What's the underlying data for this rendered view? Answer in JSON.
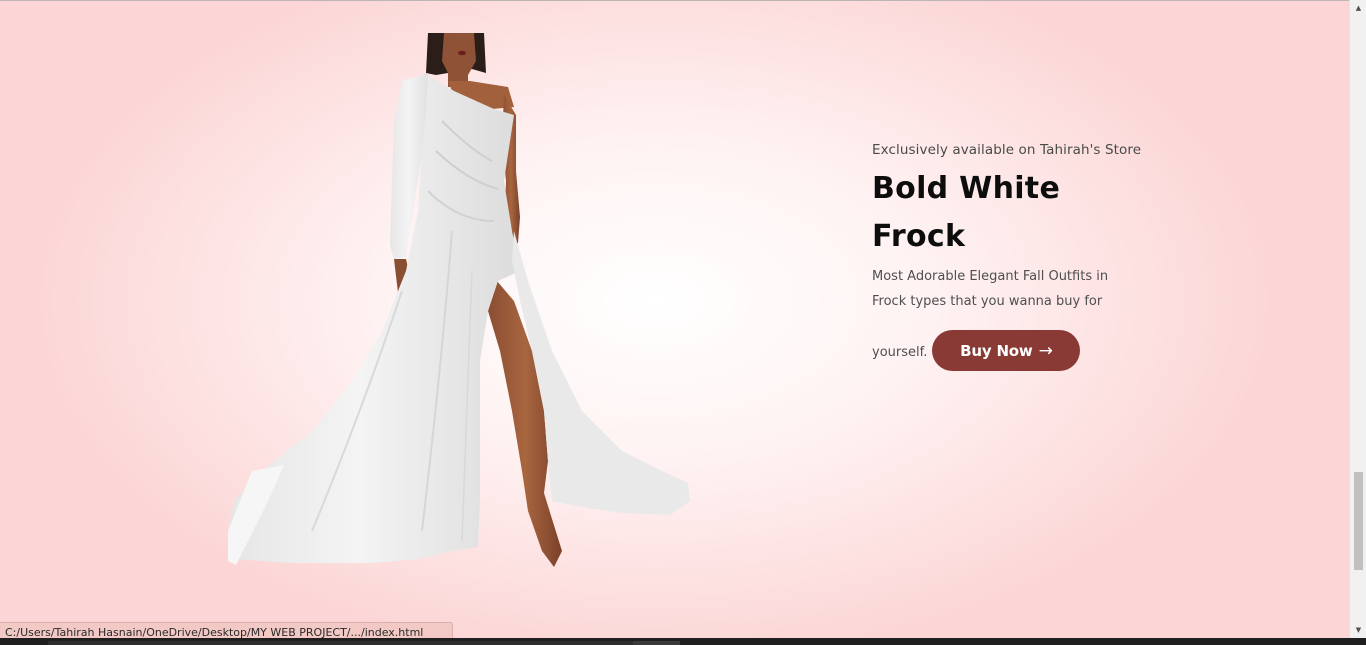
{
  "hero": {
    "eyebrow": "Exclusively available on Tahirah's Store",
    "title": "Bold White Frock",
    "description": "Most Adorable Elegant Fall Outfits in Frock types that you wanna buy for",
    "description_tail": "yourself.",
    "button_label": "Buy Now",
    "button_arrow": "→",
    "button_color": "#8a3a34"
  },
  "product_image": {
    "icon": "white-dress-model-image"
  },
  "status_bar": {
    "url": "C:/Users/Tahirah Hasnain/OneDrive/Desktop/MY WEB PROJECT/.../index.html"
  },
  "scrollbar": {
    "position": 0.75
  },
  "colors": {
    "background_center": "#ffffff",
    "background_edge": "#fcd6d6",
    "status_bar": "#f2c9c4"
  }
}
